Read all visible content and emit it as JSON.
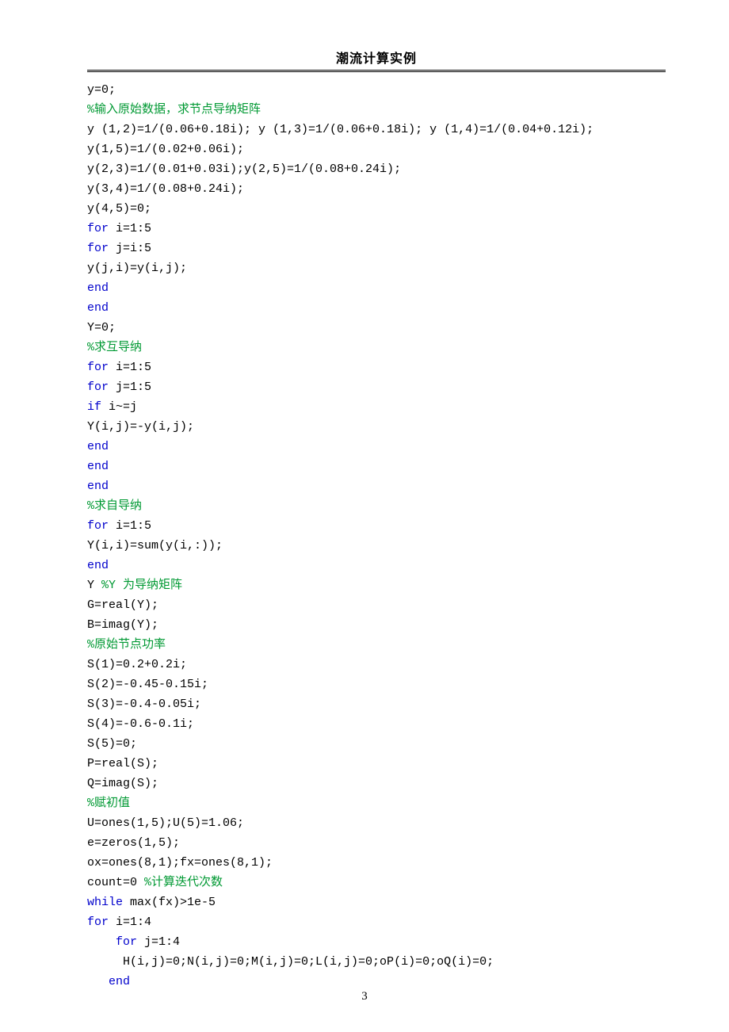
{
  "header": {
    "title": "潮流计算实例"
  },
  "code": {
    "l01": "y=0;",
    "c02": "%输入原始数据，求节点导纳矩阵",
    "l03": "y (1,2)=1/(0.06+0.18i); y (1,3)=1/(0.06+0.18i); y (1,4)=1/(0.04+0.12i);",
    "l04": "y(1,5)=1/(0.02+0.06i);",
    "l05": "y(2,3)=1/(0.01+0.03i);y(2,5)=1/(0.08+0.24i);",
    "l06": "y(3,4)=1/(0.08+0.24i);",
    "l07": "y(4,5)=0;",
    "kw_for": "for",
    "l08b": " i=1:5",
    "l09b": " j=i:5",
    "l10": "y(j,i)=y(i,j);",
    "kw_end": "end",
    "l13": "Y=0;",
    "c14": "%求互导纳",
    "l16b": " j=1:5",
    "kw_if": "if",
    "l17b": " i~=j",
    "l18": "Y(i,j)=-y(i,j);",
    "c22": "%求自导纳",
    "l24": "Y(i,i)=sum(y(i,:));",
    "l26a": "Y ",
    "c26b": "%Y 为导纳矩阵",
    "l27": "G=real(Y);",
    "l28": "B=imag(Y);",
    "c29": "%原始节点功率",
    "l30": "S(1)=0.2+0.2i;",
    "l31": "S(2)=-0.45-0.15i;",
    "l32": "S(3)=-0.4-0.05i;",
    "l33": "S(4)=-0.6-0.1i;",
    "l34": "S(5)=0;",
    "l35": "P=real(S);",
    "l36": "Q=imag(S);",
    "c37": "%赋初值",
    "l38": "U=ones(1,5);U(5)=1.06;",
    "l39": "e=zeros(1,5);",
    "l40": "ox=ones(8,1);fx=ones(8,1);",
    "l41a": "count=0 ",
    "c41b": "%计算迭代次数",
    "kw_while": "while",
    "l42b": " max(fx)>1e-5",
    "l43b": " i=1:4",
    "l44a": "    ",
    "l44b": " j=1:4",
    "l45": "     H(i,j)=0;N(i,j)=0;M(i,j)=0;L(i,j)=0;oP(i)=0;oQ(i)=0;",
    "l46a": "   "
  },
  "page_number": "3"
}
